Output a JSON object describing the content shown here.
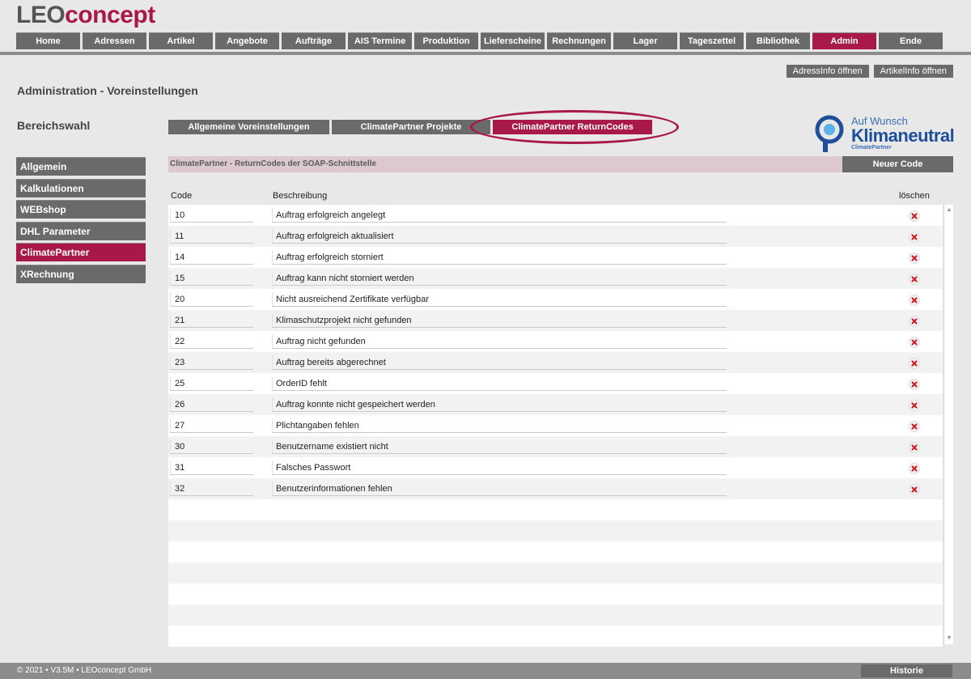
{
  "logo": {
    "part1": "LEO",
    "part2": "concept"
  },
  "nav": [
    {
      "label": "Home"
    },
    {
      "label": "Adressen"
    },
    {
      "label": "Artikel"
    },
    {
      "label": "Angebote"
    },
    {
      "label": "Aufträge"
    },
    {
      "label": "AIS Termine"
    },
    {
      "label": "Produktion"
    },
    {
      "label": "Lieferscheine"
    },
    {
      "label": "Rechnungen"
    },
    {
      "label": "Lager"
    },
    {
      "label": "Tageszettel"
    },
    {
      "label": "Bibliothek"
    },
    {
      "label": "Admin",
      "active": true
    },
    {
      "label": "Ende"
    }
  ],
  "top_actions": {
    "adressinfo": "AdressInfo öffnen",
    "artikelinfo": "ArtikelInfo öffnen"
  },
  "page_title": "Administration - Voreinstellungen",
  "section_title": "Bereichswahl",
  "sidebar": [
    {
      "label": "Allgemein"
    },
    {
      "label": "Kalkulationen"
    },
    {
      "label": "WEBshop"
    },
    {
      "label": "DHL Parameter"
    },
    {
      "label": "ClimatePartner",
      "active": true
    },
    {
      "label": "XRechnung"
    }
  ],
  "tabs": [
    {
      "label": "Allgemeine Voreinstellungen"
    },
    {
      "label": "ClimatePartner Projekte"
    },
    {
      "label": "ClimatePartner ReturnCodes",
      "active": true
    }
  ],
  "brand": {
    "line1": "Auf Wunsch",
    "line2": "Klimaneutral",
    "line3": "ClimatePartner"
  },
  "section": {
    "label": "ClimatePartner - ReturnCodes der SOAP-Schnittstelle",
    "new_button": "Neuer Code"
  },
  "columns": {
    "code": "Code",
    "description": "Beschreibung",
    "delete": "löschen"
  },
  "rows": [
    {
      "code": "10",
      "desc": "Auftrag erfolgreich angelegt"
    },
    {
      "code": "11",
      "desc": "Auftrag erfolgreich aktualisiert"
    },
    {
      "code": "14",
      "desc": "Auftrag erfolgreich storniert"
    },
    {
      "code": "15",
      "desc": "Auftrag kann nicht storniert werden"
    },
    {
      "code": "20",
      "desc": "Nicht ausreichend Zertifikate verfügbar"
    },
    {
      "code": "21",
      "desc": "Klimaschutzprojekt nicht gefunden"
    },
    {
      "code": "22",
      "desc": "Auftrag nicht gefunden"
    },
    {
      "code": "23",
      "desc": "Auftrag bereits abgerechnet"
    },
    {
      "code": "25",
      "desc": "OrderID fehlt"
    },
    {
      "code": "26",
      "desc": "Auftrag konnte nicht gespeichert werden"
    },
    {
      "code": "27",
      "desc": "Plichtangaben fehlen"
    },
    {
      "code": "30",
      "desc": "Benutzername existiert nicht"
    },
    {
      "code": "31",
      "desc": "Falsches Passwort"
    },
    {
      "code": "32",
      "desc": "Benutzerinformationen fehlen"
    }
  ],
  "footer": {
    "copyright": "© 2021 • V3.5M • LEOconcept GmbH",
    "history": "Historie"
  },
  "colors": {
    "accent": "#a8194a",
    "button": "#6a6a6a",
    "brand_blue": "#1e4f9a"
  }
}
